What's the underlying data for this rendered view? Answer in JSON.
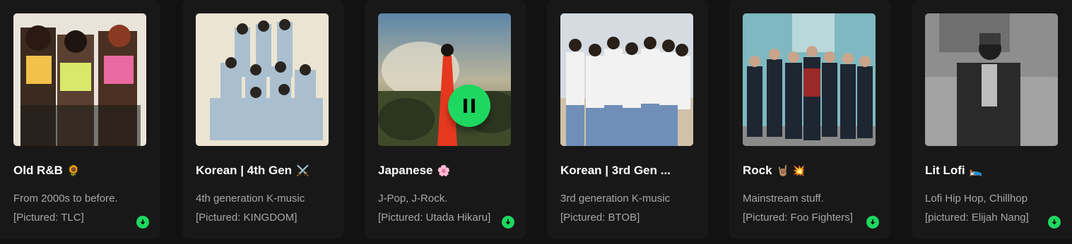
{
  "cards": [
    {
      "title": "Old R&B",
      "emoji": "🌻",
      "line1": "From 2000s to before.",
      "line2": "[Pictured: TLC]"
    },
    {
      "title": "Korean | 4th Gen",
      "emoji": "⚔️",
      "line1": "4th generation K-music",
      "line2": "[Pictured: KINGDOM]"
    },
    {
      "title": "Japanese",
      "emoji": "🌸",
      "line1": "J-Pop, J-Rock.",
      "line2": "[Pictured: Utada Hikaru]"
    },
    {
      "title": "Korean | 3rd Gen ...",
      "emoji": "",
      "line1": "3rd generation K-music",
      "line2": "[Pictured: BTOB]"
    },
    {
      "title": "Rock",
      "emoji": "🤘🏽 💥",
      "line1": "Mainstream stuff.",
      "line2": "[Pictured: Foo Fighters]"
    },
    {
      "title": "Lit Lofi",
      "emoji": "🛌",
      "line1": "Lofi Hip Hop, Chillhop",
      "line2": "[pictured: Elijah Nang]"
    }
  ],
  "icons": {
    "download": "download-circle-icon",
    "pause": "pause-icon"
  },
  "colors": {
    "background": "#121212",
    "card": "#181818",
    "accent": "#1ed760",
    "text_primary": "#ffffff",
    "text_secondary": "#a7a7a7"
  }
}
